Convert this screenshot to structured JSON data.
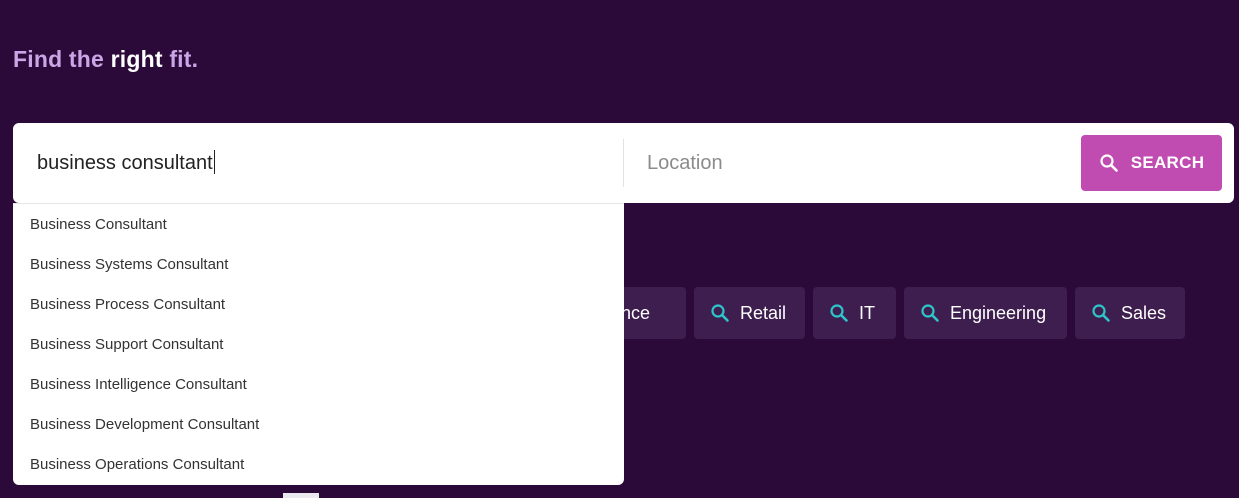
{
  "headline": {
    "part1": "Find the",
    "emphasis": "right",
    "part2": "fit."
  },
  "search": {
    "keyword_value": "business consultant",
    "location_placeholder": "Location",
    "button_label": "SEARCH",
    "button_icon": "search-icon"
  },
  "autocomplete": {
    "items": [
      "Business Consultant",
      "Business Systems Consultant",
      "Business Process Consultant",
      "Business Support Consultant",
      "Business Intelligence Consultant",
      "Business Development Consultant",
      "Business Operations Consultant"
    ]
  },
  "chips": {
    "icon": "search-icon",
    "items": [
      {
        "label": "Finance"
      },
      {
        "label": "Retail"
      },
      {
        "label": "IT"
      },
      {
        "label": "Engineering"
      },
      {
        "label": "Sales"
      }
    ]
  },
  "colors": {
    "background": "#2b0a3a",
    "headline": "#c9a6e6",
    "accent": "#c04bb1",
    "chip_bg": "#3d1e4e",
    "chip_icon": "#2ec4c9"
  }
}
